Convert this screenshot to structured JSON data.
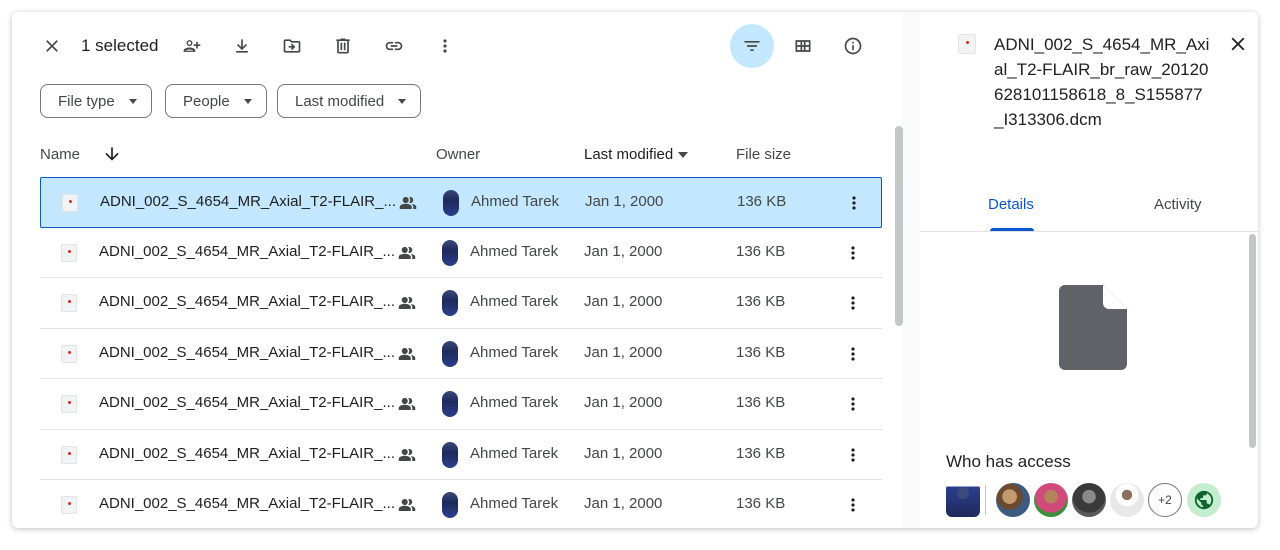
{
  "toolbar": {
    "selection_label": "1 selected",
    "icons": [
      "close-icon",
      "share-icon",
      "download-icon",
      "move-icon",
      "trash-icon",
      "link-icon",
      "more-icon",
      "filter-icon",
      "grid-view-icon",
      "info-icon"
    ]
  },
  "filters": {
    "file_type": "File type",
    "people": "People",
    "last_modified": "Last modified"
  },
  "columns": {
    "name": "Name",
    "owner": "Owner",
    "last_modified": "Last modified",
    "file_size": "File size"
  },
  "files": [
    {
      "name": "ADNI_002_S_4654_MR_Axial_T2-FLAIR_...",
      "owner": "Ahmed Tarek",
      "modified": "Jan 1, 2000",
      "size": "136 KB",
      "selected": true
    },
    {
      "name": "ADNI_002_S_4654_MR_Axial_T2-FLAIR_...",
      "owner": "Ahmed Tarek",
      "modified": "Jan 1, 2000",
      "size": "136 KB",
      "selected": false
    },
    {
      "name": "ADNI_002_S_4654_MR_Axial_T2-FLAIR_...",
      "owner": "Ahmed Tarek",
      "modified": "Jan 1, 2000",
      "size": "136 KB",
      "selected": false
    },
    {
      "name": "ADNI_002_S_4654_MR_Axial_T2-FLAIR_...",
      "owner": "Ahmed Tarek",
      "modified": "Jan 1, 2000",
      "size": "136 KB",
      "selected": false
    },
    {
      "name": "ADNI_002_S_4654_MR_Axial_T2-FLAIR_...",
      "owner": "Ahmed Tarek",
      "modified": "Jan 1, 2000",
      "size": "136 KB",
      "selected": false
    },
    {
      "name": "ADNI_002_S_4654_MR_Axial_T2-FLAIR_...",
      "owner": "Ahmed Tarek",
      "modified": "Jan 1, 2000",
      "size": "136 KB",
      "selected": false
    },
    {
      "name": "ADNI_002_S_4654_MR_Axial_T2-FLAIR_...",
      "owner": "Ahmed Tarek",
      "modified": "Jan 1, 2000",
      "size": "136 KB",
      "selected": false
    }
  ],
  "details": {
    "title": "ADNI_002_S_4654_MR_Axial_T2-FLAIR_br_raw_20120628101158618_8_S155877_I313306.dcm",
    "tabs": [
      "Details",
      "Activity"
    ],
    "active_tab": "Details",
    "access_title": "Who has access",
    "access_more": "+2"
  },
  "colors": {
    "accent": "#0b57d0",
    "selected_bg": "#c2e7ff"
  }
}
